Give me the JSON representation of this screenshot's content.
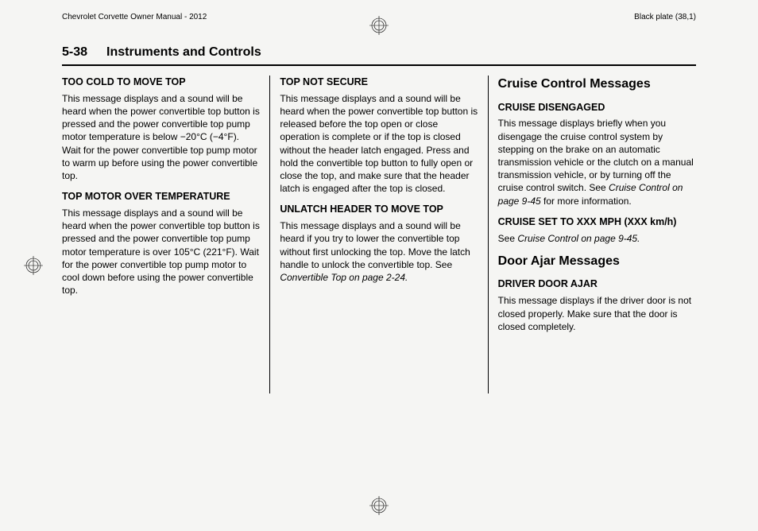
{
  "header": {
    "manual_title": "Chevrolet Corvette Owner Manual - 2012",
    "plate_info": "Black plate (38,1)"
  },
  "page": {
    "number": "5-38",
    "title": "Instruments and Controls"
  },
  "col1": {
    "h1": "TOO COLD TO MOVE TOP",
    "p1": "This message displays and a sound will be heard when the power convertible top button is pressed and the power convertible top pump motor temperature is below −20°C (−4°F). Wait for the power convertible top pump motor to warm up before using the power convertible top.",
    "h2": "TOP MOTOR OVER TEMPERATURE",
    "p2": "This message displays and a sound will be heard when the power convertible top button is pressed and the power convertible top pump motor temperature is over 105°C (221°F). Wait for the power convertible top pump motor to cool down before using the power convertible top."
  },
  "col2": {
    "h1": "TOP NOT SECURE",
    "p1": "This message displays and a sound will be heard when the power convertible top button is released before the top open or close operation is complete or if the top is closed without the header latch engaged. Press and hold the convertible top button to fully open or close the top, and make sure that the header latch is engaged after the top is closed.",
    "h2": "UNLATCH HEADER TO MOVE TOP",
    "p2a": "This message displays and a sound will be heard if you try to lower the convertible top without first unlocking the top. Move the latch handle to unlock the convertible top. See ",
    "p2b": "Convertible Top on page 2‑24."
  },
  "col3": {
    "sh1": "Cruise Control Messages",
    "h1": "CRUISE DISENGAGED",
    "p1a": "This message displays briefly when you disengage the cruise control system by stepping on the brake on an automatic transmission vehicle or the clutch on a manual transmission vehicle, or by turning off the cruise control switch. See ",
    "p1b": "Cruise Control on page 9‑45",
    "p1c": " for more information.",
    "h2": "CRUISE SET TO XXX MPH (XXX km/h)",
    "p2a": "See ",
    "p2b": "Cruise Control on page 9‑45.",
    "sh2": "Door Ajar Messages",
    "h3": "DRIVER DOOR AJAR",
    "p3": "This message displays if the driver door is not closed properly. Make sure that the door is closed completely."
  }
}
